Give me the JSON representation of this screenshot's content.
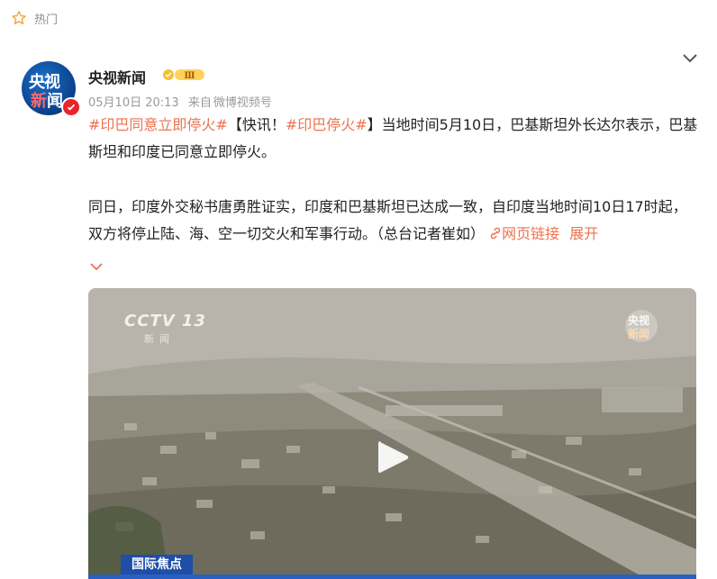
{
  "header": {
    "hot_label": "热门"
  },
  "post": {
    "author": "央视新闻",
    "avatar": {
      "line1": "央视",
      "line2a": "新",
      "line2b": "闻"
    },
    "level_badge": "Ⅲ",
    "time": "05月10日 20:13",
    "source_prefix": "来自",
    "source": "微博视频号",
    "p1": {
      "tag1": "#印巴同意立即停火#",
      "text1": "【快讯！",
      "tag2": "#印巴停火#",
      "text2": "】当地时间5月10日，巴基斯坦外长达尔表示，巴基斯坦和印度已同意立即停火。"
    },
    "p2": {
      "text": "同日，印度外交秘书唐勇胜证实，印度和巴基斯坦已达成一致，自印度当地时间10日17时起，双方将停止陆、海、空一切交火和军事行动。（总台记者崔如）",
      "link": "网页链接",
      "expand": "展开"
    },
    "video": {
      "channel": "CCTV 13",
      "channel_sub": "新闻",
      "watermark_a": "央视",
      "watermark_b": "新闻",
      "lower_third": "国际焦点"
    }
  },
  "colors": {
    "accent": "#eb7350",
    "brand_blue": "#1f4ea8",
    "verified": "#e8242c"
  },
  "icons": [
    "star-icon",
    "chevron-down-icon",
    "verified-icon",
    "level-badge-icon",
    "link-icon",
    "play-icon"
  ]
}
